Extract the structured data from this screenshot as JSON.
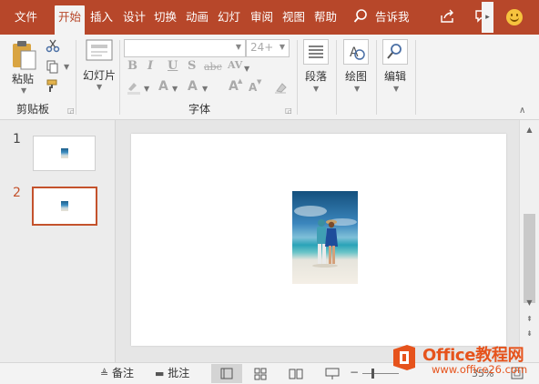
{
  "colors": {
    "accent": "#b7472a",
    "slide_active": "#c4522c",
    "watermark": "#e6531c"
  },
  "tabs": [
    {
      "label": "文件"
    },
    {
      "label": "开始",
      "active": true
    },
    {
      "label": "插入"
    },
    {
      "label": "设计"
    },
    {
      "label": "切换"
    },
    {
      "label": "动画"
    },
    {
      "label": "幻灯"
    },
    {
      "label": "审阅"
    },
    {
      "label": "视图"
    },
    {
      "label": "帮助"
    }
  ],
  "tell_me": "告诉我",
  "icons": {
    "tell": "lightbulb-search-icon",
    "share": "share-icon",
    "comments": "comments-icon",
    "smiley": "smiley-icon"
  },
  "ribbon": {
    "clipboard": {
      "paste": "粘贴",
      "group": "剪贴板"
    },
    "slides": {
      "new_slide": "幻灯片"
    },
    "font": {
      "group": "字体",
      "font_name": "",
      "font_size": "24+",
      "bold": "B",
      "italic": "I",
      "underline": "U",
      "shadow": "S",
      "strike": "abc",
      "spacing": "AV",
      "font_color": "A",
      "size_font": "A",
      "grow": "A",
      "shrink": "A"
    },
    "paragraph": {
      "label": "段落"
    },
    "drawing": {
      "label": "绘图"
    },
    "editing": {
      "label": "编辑"
    }
  },
  "slides": [
    {
      "number": "1"
    },
    {
      "number": "2",
      "active": true
    }
  ],
  "statusbar": {
    "notes": "备注",
    "comments": "批注",
    "zoom": "35%"
  },
  "watermark": {
    "title": "Office教程网",
    "url": "www.office26.com"
  }
}
